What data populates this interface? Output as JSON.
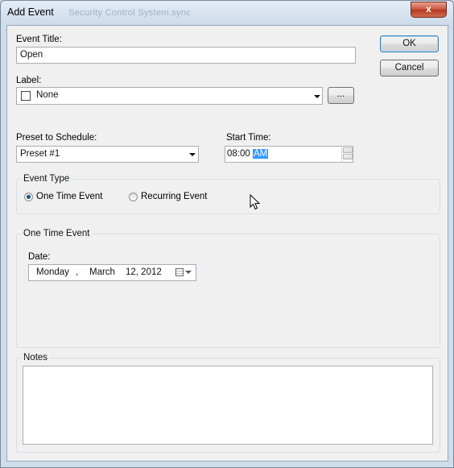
{
  "window": {
    "title": "Add Event",
    "title_ghost": "Security Control System.sync",
    "close_glyph": "x"
  },
  "form": {
    "event_title_label": "Event Title:",
    "event_title_value": "Open",
    "label_label": "Label:",
    "label_value": "None",
    "ellipsis_button": "...",
    "preset_label": "Preset to Schedule:",
    "preset_value": "Preset #1",
    "start_time_label": "Start Time:",
    "start_time_hm": "08:00",
    "start_time_ampm": "AM"
  },
  "buttons": {
    "ok": "OK",
    "cancel": "Cancel"
  },
  "event_type": {
    "title": "Event Type",
    "one_time": "One Time Event",
    "recurring": "Recurring Event",
    "selected": "one_time"
  },
  "one_time_event": {
    "title": "One Time Event",
    "date_label": "Date:",
    "day": "Monday",
    "sep": ",",
    "month": "March",
    "day_year": "12, 2012"
  },
  "notes": {
    "title": "Notes",
    "value": ""
  }
}
